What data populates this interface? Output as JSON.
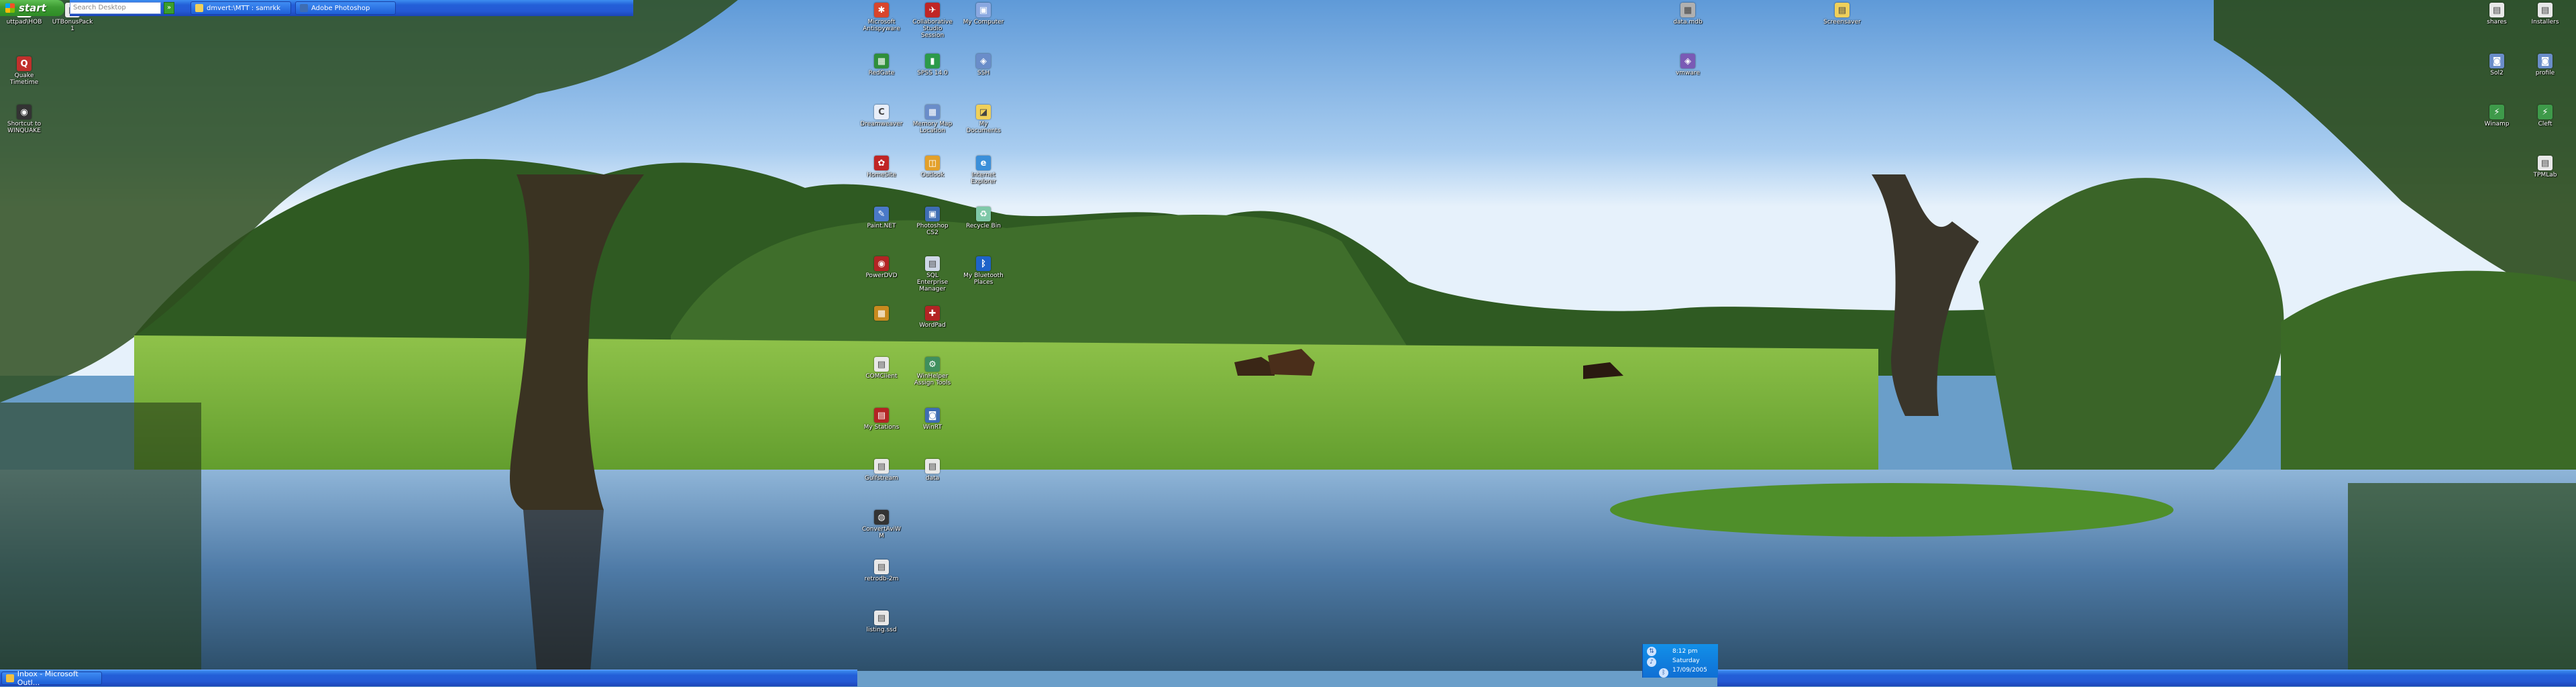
{
  "desktop": {
    "icons": [
      {
        "id": "uttpad",
        "label": "uttpad\\HOB",
        "color": "#ffffff",
        "symbol": "▤"
      },
      {
        "id": "utbonus",
        "label": "UTBonusPack1",
        "color": "#eaeaea",
        "symbol": "▤"
      },
      {
        "id": "quake",
        "label": "Quake Timetime",
        "color": "#c0302c",
        "symbol": "Q"
      },
      {
        "id": "winquake",
        "label": "Shortcut to WINQUAKE",
        "color": "#333333",
        "symbol": "◉"
      },
      {
        "id": "c1r1",
        "label": "Microsoft Antispyware",
        "color": "#d9452c",
        "symbol": "✱"
      },
      {
        "id": "c1r2",
        "label": "RedGate",
        "color": "#2f8f3b",
        "symbol": "▦"
      },
      {
        "id": "c1r3",
        "label": "Dreamweaver",
        "color": "#e8eef8",
        "symbol": "C"
      },
      {
        "id": "c1r4",
        "label": "HomeSite",
        "color": "#c02525",
        "symbol": "✿"
      },
      {
        "id": "c1r5",
        "label": "Paint.NET",
        "color": "#4a79c8",
        "symbol": "✎"
      },
      {
        "id": "c1r6",
        "label": "PowerDVD",
        "color": "#b32424",
        "symbol": "◉"
      },
      {
        "id": "c1r7",
        "label": "",
        "color": "#c88a1e",
        "symbol": "▦"
      },
      {
        "id": "c1r8",
        "label": "COMClient",
        "color": "#e8e8e8",
        "symbol": "▤"
      },
      {
        "id": "c1r9",
        "label": "My Stations",
        "color": "#b32424",
        "symbol": "▤"
      },
      {
        "id": "c1r10",
        "label": "Gulfstream",
        "color": "#e8e8e8",
        "symbol": "▤"
      },
      {
        "id": "c1r11",
        "label": "ConvertAviWM",
        "color": "#333333",
        "symbol": "◍"
      },
      {
        "id": "c1r12",
        "label": "retrodb-2m",
        "color": "#e8e8e8",
        "symbol": "▤"
      },
      {
        "id": "c1r13",
        "label": "listing.ssd",
        "color": "#e8e8e8",
        "symbol": "▤"
      },
      {
        "id": "c2r1",
        "label": "Collaborative Studio Session",
        "color": "#c02525",
        "symbol": "✈"
      },
      {
        "id": "c2r2",
        "label": "SPSS 14.0",
        "color": "#2c9a4a",
        "symbol": "▮"
      },
      {
        "id": "c2r3",
        "label": "Memory Map Location",
        "color": "#6a8dc9",
        "symbol": "▦"
      },
      {
        "id": "c2r4",
        "label": "Outlook",
        "color": "#e3a02a",
        "symbol": "◫"
      },
      {
        "id": "c2r5",
        "label": "Photoshop CS2",
        "color": "#3e6db3",
        "symbol": "▣"
      },
      {
        "id": "c2r6",
        "label": "SQL Enterprise Manager",
        "color": "#cfd8e8",
        "symbol": "▤"
      },
      {
        "id": "c2r7",
        "label": "WordPad",
        "color": "#b32424",
        "symbol": "✚"
      },
      {
        "id": "c2r8",
        "label": "WinHelper Assign Tools",
        "color": "#3f8f5e",
        "symbol": "⚙"
      },
      {
        "id": "c2r9",
        "label": "WinRT",
        "color": "#3e6db3",
        "symbol": "◙"
      },
      {
        "id": "c2r10",
        "label": "data",
        "color": "#e8e8e8",
        "symbol": "▤"
      },
      {
        "id": "c3r1",
        "label": "My Computer",
        "color": "#8aa8e0",
        "symbol": "▣"
      },
      {
        "id": "c3r2",
        "label": "SSH",
        "color": "#6a8dc9",
        "symbol": "◈"
      },
      {
        "id": "c3r3",
        "label": "My Documents",
        "color": "#f0d05a",
        "symbol": "◪"
      },
      {
        "id": "c3r4",
        "label": "Internet Explorer",
        "color": "#3b8fd9",
        "symbol": "e"
      },
      {
        "id": "c3r5",
        "label": "Recycle Bin",
        "color": "#7fc8a8",
        "symbol": "♻"
      },
      {
        "id": "c3r6",
        "label": "My Bluetooth Places",
        "color": "#1e63c9",
        "symbol": "ᛒ"
      },
      {
        "id": "c4r1",
        "label": "data.mdb",
        "color": "#b0b0b0",
        "symbol": "▦"
      },
      {
        "id": "c4r2",
        "label": "vmware",
        "color": "#7a5ab5",
        "symbol": "◈"
      },
      {
        "id": "c5r1",
        "label": "Screensaver",
        "color": "#f0d05a",
        "symbol": "▤"
      },
      {
        "id": "c6r1",
        "label": "shares",
        "color": "#e8e8e8",
        "symbol": "▤"
      },
      {
        "id": "c6r2",
        "label": "Sol2",
        "color": "#6a8dc9",
        "symbol": "◙"
      },
      {
        "id": "c6r3",
        "label": "Winamp",
        "color": "#3e9a4a",
        "symbol": "⚡"
      },
      {
        "id": "c7r1",
        "label": "Installers",
        "color": "#e8e8e8",
        "symbol": "▤"
      },
      {
        "id": "c7r2",
        "label": "profile",
        "color": "#6a8dc9",
        "symbol": "◙"
      },
      {
        "id": "c7r3",
        "label": "Cleft",
        "color": "#3e9a4a",
        "symbol": "⚡"
      },
      {
        "id": "c7r4",
        "label": "TPMLab",
        "color": "#e8e8e8",
        "symbol": "▤"
      }
    ]
  },
  "taskbar": {
    "left_item": "Inbox - Microsoft Outl...",
    "start_label": "start",
    "search_placeholder": "Search Desktop",
    "search_go": "»",
    "items": [
      "dmvert:\\MTT : samrkk",
      "Adobe Photoshop"
    ],
    "clock": {
      "time": "8:12 pm",
      "day": "Saturday",
      "date": "17/09/2005"
    }
  }
}
